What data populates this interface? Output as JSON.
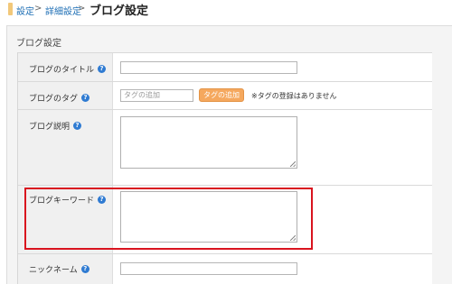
{
  "breadcrumb": {
    "items": [
      "設定",
      "詳細設定"
    ],
    "separator": ">",
    "current": "ブログ設定"
  },
  "panel": {
    "title": "ブログ設定"
  },
  "form": {
    "help_glyph": "?",
    "blog_title": {
      "label": "ブログのタイトル",
      "value": ""
    },
    "blog_tag": {
      "label": "ブログのタグ",
      "placeholder": "タグの追加",
      "button_label": "タグの追加",
      "note": "※タグの登録はありません"
    },
    "blog_description": {
      "label": "ブログ説明",
      "value": ""
    },
    "blog_keyword": {
      "label": "ブログキーワード",
      "value": ""
    },
    "nickname": {
      "label": "ニックネーム",
      "value": ""
    }
  },
  "colors": {
    "accent_link": "#1f6fb5",
    "help_icon": "#2f7bd2",
    "tag_button": "#f5a85e",
    "highlight_box": "#d9141f"
  }
}
